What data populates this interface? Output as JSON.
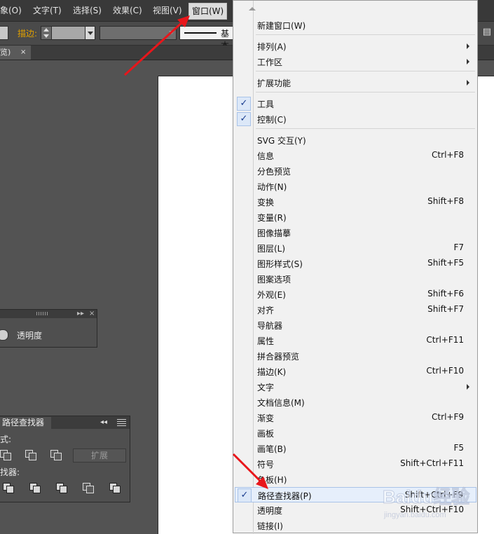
{
  "menubar": {
    "items": [
      "象(O)",
      "文字(T)",
      "选择(S)",
      "效果(C)",
      "视图(V)",
      "窗口(W)"
    ]
  },
  "controlbar": {
    "stroke_label": "描边:",
    "profile_text": "基本"
  },
  "doc_tab": {
    "title": "览)",
    "close": "×"
  },
  "transparency_panel": {
    "label": "透明度",
    "collapse": "▸▸",
    "close": "×"
  },
  "pathfinder_panel": {
    "tab": "路径查找器",
    "collapse": "◂◂",
    "shape_modes_label": "式:",
    "pathfinders_label": "找器:",
    "expand_button": "扩展"
  },
  "window_menu": {
    "items": [
      {
        "label": "新建窗口(W)",
        "shortcut": "",
        "submenu": false,
        "checked": false
      },
      {
        "label": "排列(A)",
        "shortcut": "",
        "submenu": true,
        "checked": false
      },
      {
        "label": "工作区",
        "shortcut": "",
        "submenu": true,
        "checked": false
      },
      {
        "label": "扩展功能",
        "shortcut": "",
        "submenu": true,
        "checked": false
      },
      {
        "label": "工具",
        "shortcut": "",
        "submenu": false,
        "checked": true
      },
      {
        "label": "控制(C)",
        "shortcut": "",
        "submenu": false,
        "checked": true
      },
      {
        "label": "SVG 交互(Y)",
        "shortcut": "",
        "submenu": false,
        "checked": false
      },
      {
        "label": "信息",
        "shortcut": "Ctrl+F8",
        "submenu": false,
        "checked": false
      },
      {
        "label": "分色预览",
        "shortcut": "",
        "submenu": false,
        "checked": false
      },
      {
        "label": "动作(N)",
        "shortcut": "",
        "submenu": false,
        "checked": false
      },
      {
        "label": "变换",
        "shortcut": "Shift+F8",
        "submenu": false,
        "checked": false
      },
      {
        "label": "变量(R)",
        "shortcut": "",
        "submenu": false,
        "checked": false
      },
      {
        "label": "图像描摹",
        "shortcut": "",
        "submenu": false,
        "checked": false
      },
      {
        "label": "图层(L)",
        "shortcut": "F7",
        "submenu": false,
        "checked": false
      },
      {
        "label": "图形样式(S)",
        "shortcut": "Shift+F5",
        "submenu": false,
        "checked": false
      },
      {
        "label": "图案选项",
        "shortcut": "",
        "submenu": false,
        "checked": false
      },
      {
        "label": "外观(E)",
        "shortcut": "Shift+F6",
        "submenu": false,
        "checked": false
      },
      {
        "label": "对齐",
        "shortcut": "Shift+F7",
        "submenu": false,
        "checked": false
      },
      {
        "label": "导航器",
        "shortcut": "",
        "submenu": false,
        "checked": false
      },
      {
        "label": "属性",
        "shortcut": "Ctrl+F11",
        "submenu": false,
        "checked": false
      },
      {
        "label": "拼合器预览",
        "shortcut": "",
        "submenu": false,
        "checked": false
      },
      {
        "label": "描边(K)",
        "shortcut": "Ctrl+F10",
        "submenu": false,
        "checked": false
      },
      {
        "label": "文字",
        "shortcut": "",
        "submenu": true,
        "checked": false
      },
      {
        "label": "文档信息(M)",
        "shortcut": "",
        "submenu": false,
        "checked": false
      },
      {
        "label": "渐变",
        "shortcut": "Ctrl+F9",
        "submenu": false,
        "checked": false
      },
      {
        "label": "画板",
        "shortcut": "",
        "submenu": false,
        "checked": false
      },
      {
        "label": "画笔(B)",
        "shortcut": "F5",
        "submenu": false,
        "checked": false
      },
      {
        "label": "符号",
        "shortcut": "Shift+Ctrl+F11",
        "submenu": false,
        "checked": false
      },
      {
        "label": "色板(H)",
        "shortcut": "",
        "submenu": false,
        "checked": false
      },
      {
        "label": "路径查找器(P)",
        "shortcut": "Shift+Ctrl+F9",
        "submenu": false,
        "checked": true,
        "highlighted": true
      },
      {
        "label": "透明度",
        "shortcut": "Shift+Ctrl+F10",
        "submenu": false,
        "checked": false
      },
      {
        "label": "链接(I)",
        "shortcut": "",
        "submenu": false,
        "checked": false
      }
    ]
  },
  "watermark": {
    "text": "Baidu经验",
    "subtext": "jingyan.baidu.com"
  },
  "colors": {
    "arrow": "#e8161b",
    "menu_bg": "#f1f1f1",
    "highlight": "#e6effb",
    "app_bg": "#535353"
  }
}
